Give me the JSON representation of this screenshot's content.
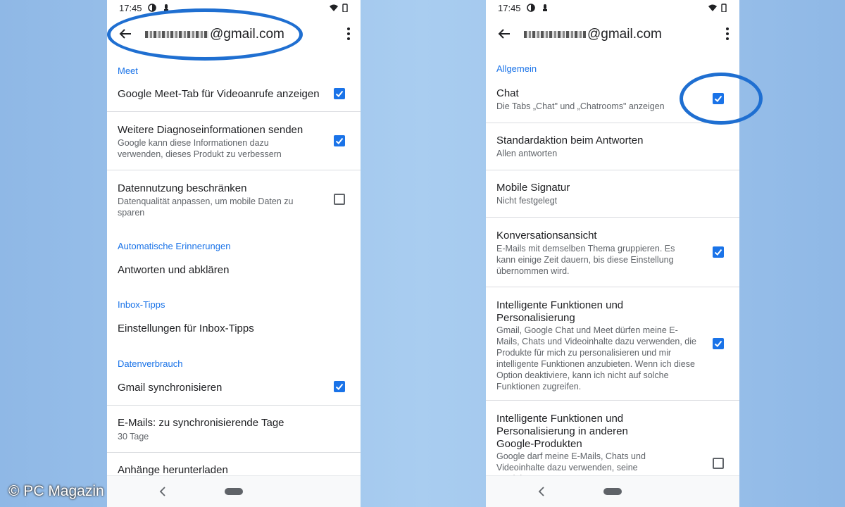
{
  "status_time": "17:45",
  "account_left": "@gmail.com",
  "account_right": "@gmail.com",
  "left": {
    "section_meet": "Meet",
    "meet_tab": "Google Meet-Tab für Videoanrufe anzeigen",
    "diag_title": "Weitere Diagnoseinformationen senden",
    "diag_sub": "Google kann diese Informationen dazu verwenden, dieses Produkt zu verbessern",
    "data_title": "Datennutzung beschränken",
    "data_sub": "Datenqualität anpassen, um mobile Daten zu sparen",
    "section_reminders": "Automatische Erinnerungen",
    "reminders_item": "Antworten und abklären",
    "section_inbox": "Inbox-Tipps",
    "inbox_item": "Einstellungen für Inbox-Tipps",
    "section_usage": "Datenverbrauch",
    "sync_title": "Gmail synchronisieren",
    "days_title": "E-Mails: zu synchronisierende Tage",
    "days_sub": "30 Tage",
    "attach_title": "Anhänge herunterladen"
  },
  "right": {
    "section_general": "Allgemein",
    "chat_title": "Chat",
    "chat_sub": "Die Tabs „Chat\" und „Chatrooms\" anzeigen",
    "reply_title": "Standardaktion beim Antworten",
    "reply_sub": "Allen antworten",
    "sig_title": "Mobile Signatur",
    "sig_sub": "Nicht festgelegt",
    "conv_title": "Konversationsansicht",
    "conv_sub": "E-Mails mit demselben Thema gruppieren. Es kann einige Zeit dauern, bis diese Einstellung übernommen wird.",
    "smart_title": "Intelligente Funktionen und Personalisierung",
    "smart_sub": "Gmail, Google Chat und Meet dürfen meine E-Mails, Chats und Videoinhalte dazu verwenden, die Produkte für mich zu personalisieren und mir intelligente Funktionen anzubieten. Wenn ich diese Option deaktiviere, kann ich nicht auf solche Funktionen zugreifen.",
    "smart2_title": "Intelligente Funktionen und Personalisierung in anderen Google-Produkten",
    "smart2_sub": "Google darf meine E-Mails, Chats und Videoinhalte dazu verwenden, seine Produkte"
  },
  "watermark": "© PC Magazin",
  "colors": {
    "accent": "#1a73e8",
    "highlight": "#1f6fd1"
  }
}
